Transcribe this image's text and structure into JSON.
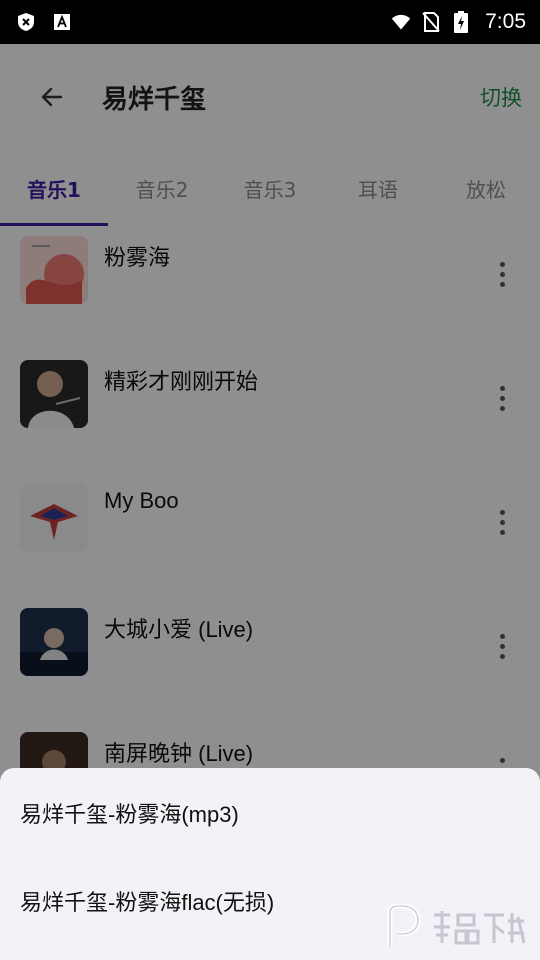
{
  "status_bar": {
    "time": "7:05",
    "icons": [
      "shield-x-icon",
      "text-a-icon",
      "wifi-icon",
      "no-sim-icon",
      "battery-charging-icon"
    ]
  },
  "app_bar": {
    "title": "易烊千玺",
    "switch_label": "切换",
    "back_icon": "arrow-left-icon"
  },
  "tabs": [
    {
      "label": "音乐1",
      "active": true
    },
    {
      "label": "音乐2",
      "active": false
    },
    {
      "label": "音乐3",
      "active": false
    },
    {
      "label": "耳语",
      "active": false
    },
    {
      "label": "放松",
      "active": false
    }
  ],
  "songs": [
    {
      "title": "粉雾海"
    },
    {
      "title": "精彩才刚刚开始"
    },
    {
      "title": "My Boo"
    },
    {
      "title": "大城小爱 (Live)"
    },
    {
      "title": "南屏晚钟 (Live)"
    }
  ],
  "bottom_sheet": {
    "options": [
      {
        "label": "易烊千玺-粉雾海(mp3)"
      },
      {
        "label": "易烊千玺-粉雾海flac(无损)"
      }
    ]
  },
  "colors": {
    "accent": "#3d1a9c",
    "switch": "#1f8a4c"
  }
}
